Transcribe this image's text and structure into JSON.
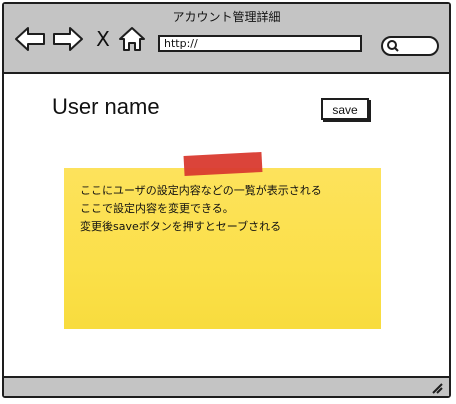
{
  "window": {
    "title": "アカウント管理詳細"
  },
  "toolbar": {
    "back_icon": "back-arrow-icon",
    "forward_icon": "forward-arrow-icon",
    "close_glyph": "X",
    "home_icon": "home-icon",
    "search_icon": "search-icon"
  },
  "address": {
    "url": "http://"
  },
  "main": {
    "username": "User name",
    "save_label": "save"
  },
  "note": {
    "lines": [
      "ここにユーザの設定内容などの一覧が表示される",
      "ここで設定内容を変更できる。",
      "変更後saveボタンを押すとセーブされる"
    ]
  },
  "colors": {
    "chrome": "#c4c4c4",
    "note": "#fbe04a",
    "tape": "#d93a2f",
    "stroke": "#1e1e1e"
  }
}
